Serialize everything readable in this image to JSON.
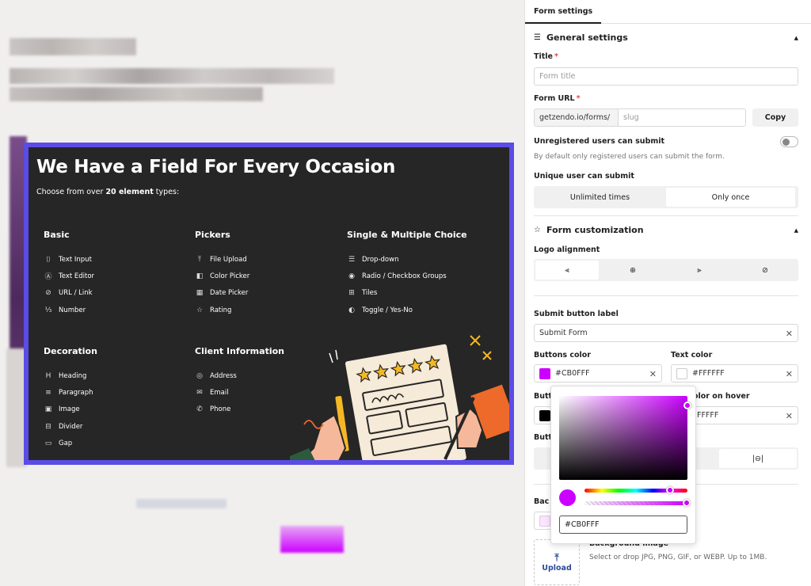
{
  "banner": {
    "title": "We Have a Field For Every Occasion",
    "subtitle_prefix": "Choose from over ",
    "subtitle_count": "20 element",
    "subtitle_suffix": " types:",
    "basic": {
      "heading": "Basic",
      "items": [
        "Text Input",
        "Text Editor",
        "URL / Link",
        "Number"
      ]
    },
    "pickers": {
      "heading": "Pickers",
      "items": [
        "File Upload",
        "Color Picker",
        "Date Picker",
        "Rating"
      ]
    },
    "choice": {
      "heading": "Single & Multiple Choice",
      "items": [
        "Drop-down",
        "Radio / Checkbox Groups",
        "Tiles",
        "Toggle / Yes-No"
      ]
    },
    "decoration": {
      "heading": "Decoration",
      "items": [
        "Heading",
        "Paragraph",
        "Image",
        "Divider",
        "Gap"
      ]
    },
    "client": {
      "heading": "Client Information",
      "items": [
        "Address",
        "Email",
        "Phone"
      ]
    },
    "stars": 5
  },
  "tabs": {
    "form_settings": "Form settings"
  },
  "general": {
    "heading": "General settings",
    "title_label": "Title",
    "title_placeholder": "Form title",
    "url_label": "Form URL",
    "url_prefix": "getzendo.io/forms/",
    "url_placeholder": "slug",
    "copy_label": "Copy",
    "unregistered_label": "Unregistered users can submit",
    "unregistered_help": "By default only registered users can submit the form.",
    "unregistered_enabled": false,
    "unique_label": "Unique user can submit",
    "unique_options": [
      "Unlimited times",
      "Only once"
    ],
    "unique_selected": "Only once"
  },
  "customization": {
    "heading": "Form customization",
    "logo_alignment_label": "Logo alignment",
    "submit_label_label": "Submit button label",
    "submit_label_value": "Submit Form",
    "buttons_color_label": "Buttons color",
    "buttons_color_value": "#CB0FFF",
    "text_color_label": "Text color",
    "text_color_value": "#FFFFFF",
    "hover_left_label": "Butt",
    "hover_right_label": "olor on hover",
    "hover_right_value": "FFFFF",
    "third_label": "Butt",
    "bg_label": "Bac",
    "bg_image_label": "Background image",
    "bg_image_help": "Select or drop JPG, PNG, GIF, or WEBP. Up to 1MB.",
    "upload_label": "Upload"
  },
  "picker": {
    "hex": "#CB0FFF"
  },
  "colors": {
    "accent": "#CB00FF",
    "banner_border": "#5B4CE6",
    "banner_bg": "#262626"
  }
}
